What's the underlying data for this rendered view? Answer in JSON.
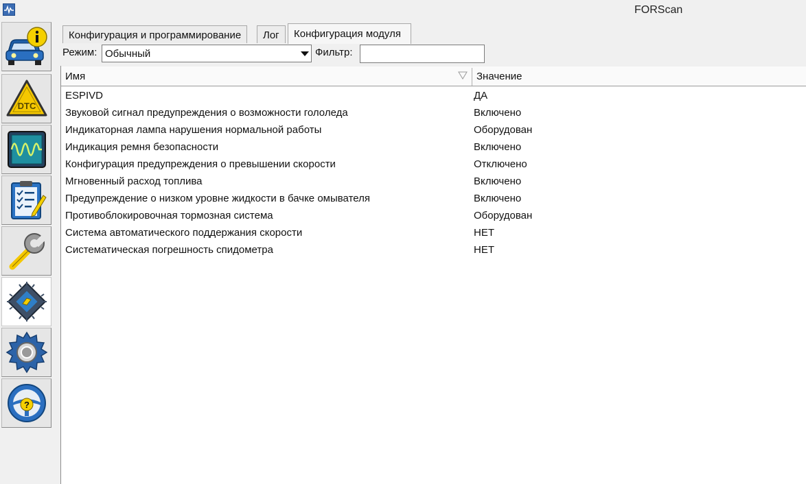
{
  "window": {
    "title": "FORScan"
  },
  "sidebar": {
    "items": [
      {
        "name": "vehicle-info",
        "icon": "car-info-icon",
        "active": false
      },
      {
        "name": "dtc",
        "icon": "dtc-warning-icon",
        "active": false
      },
      {
        "name": "oscilloscope",
        "icon": "oscilloscope-icon",
        "active": false
      },
      {
        "name": "tests",
        "icon": "checklist-icon",
        "active": false
      },
      {
        "name": "service",
        "icon": "wrench-icon",
        "active": false
      },
      {
        "name": "configuration",
        "icon": "chip-config-icon",
        "active": true
      },
      {
        "name": "settings",
        "icon": "gear-icon",
        "active": false
      },
      {
        "name": "help",
        "icon": "steering-help-icon",
        "active": false
      }
    ]
  },
  "tabs": [
    {
      "label": "Конфигурация и программирование",
      "active": false
    },
    {
      "label": "Лог",
      "active": false
    },
    {
      "label": "Конфигурация модуля",
      "active": true
    }
  ],
  "toolbar": {
    "mode_label": "Режим:",
    "mode_value": "Обычный",
    "filter_label": "Фильтр:",
    "filter_value": ""
  },
  "table": {
    "columns": [
      "Имя",
      "Значение"
    ],
    "rows": [
      {
        "name": "ESPIVD",
        "value": "ДА"
      },
      {
        "name": "Звуковой сигнал предупреждения о возможности гололеда",
        "value": "Включено"
      },
      {
        "name": "Индикаторная лампа нарушения нормальной работы",
        "value": "Оборудован"
      },
      {
        "name": "Индикация ремня безопасности",
        "value": "Включено"
      },
      {
        "name": "Конфигурация предупреждения о превышении скорости",
        "value": "Отключено"
      },
      {
        "name": "Мгновенный расход топлива",
        "value": "Включено"
      },
      {
        "name": "Предупреждение о низком уровне жидкости в бачке омывателя",
        "value": "Включено"
      },
      {
        "name": "Противоблокировочная тормозная система",
        "value": "Оборудован"
      },
      {
        "name": "Система автоматического поддержания скорости",
        "value": "НЕТ"
      },
      {
        "name": "Систематическая погрешность спидометра",
        "value": "НЕТ"
      }
    ]
  }
}
